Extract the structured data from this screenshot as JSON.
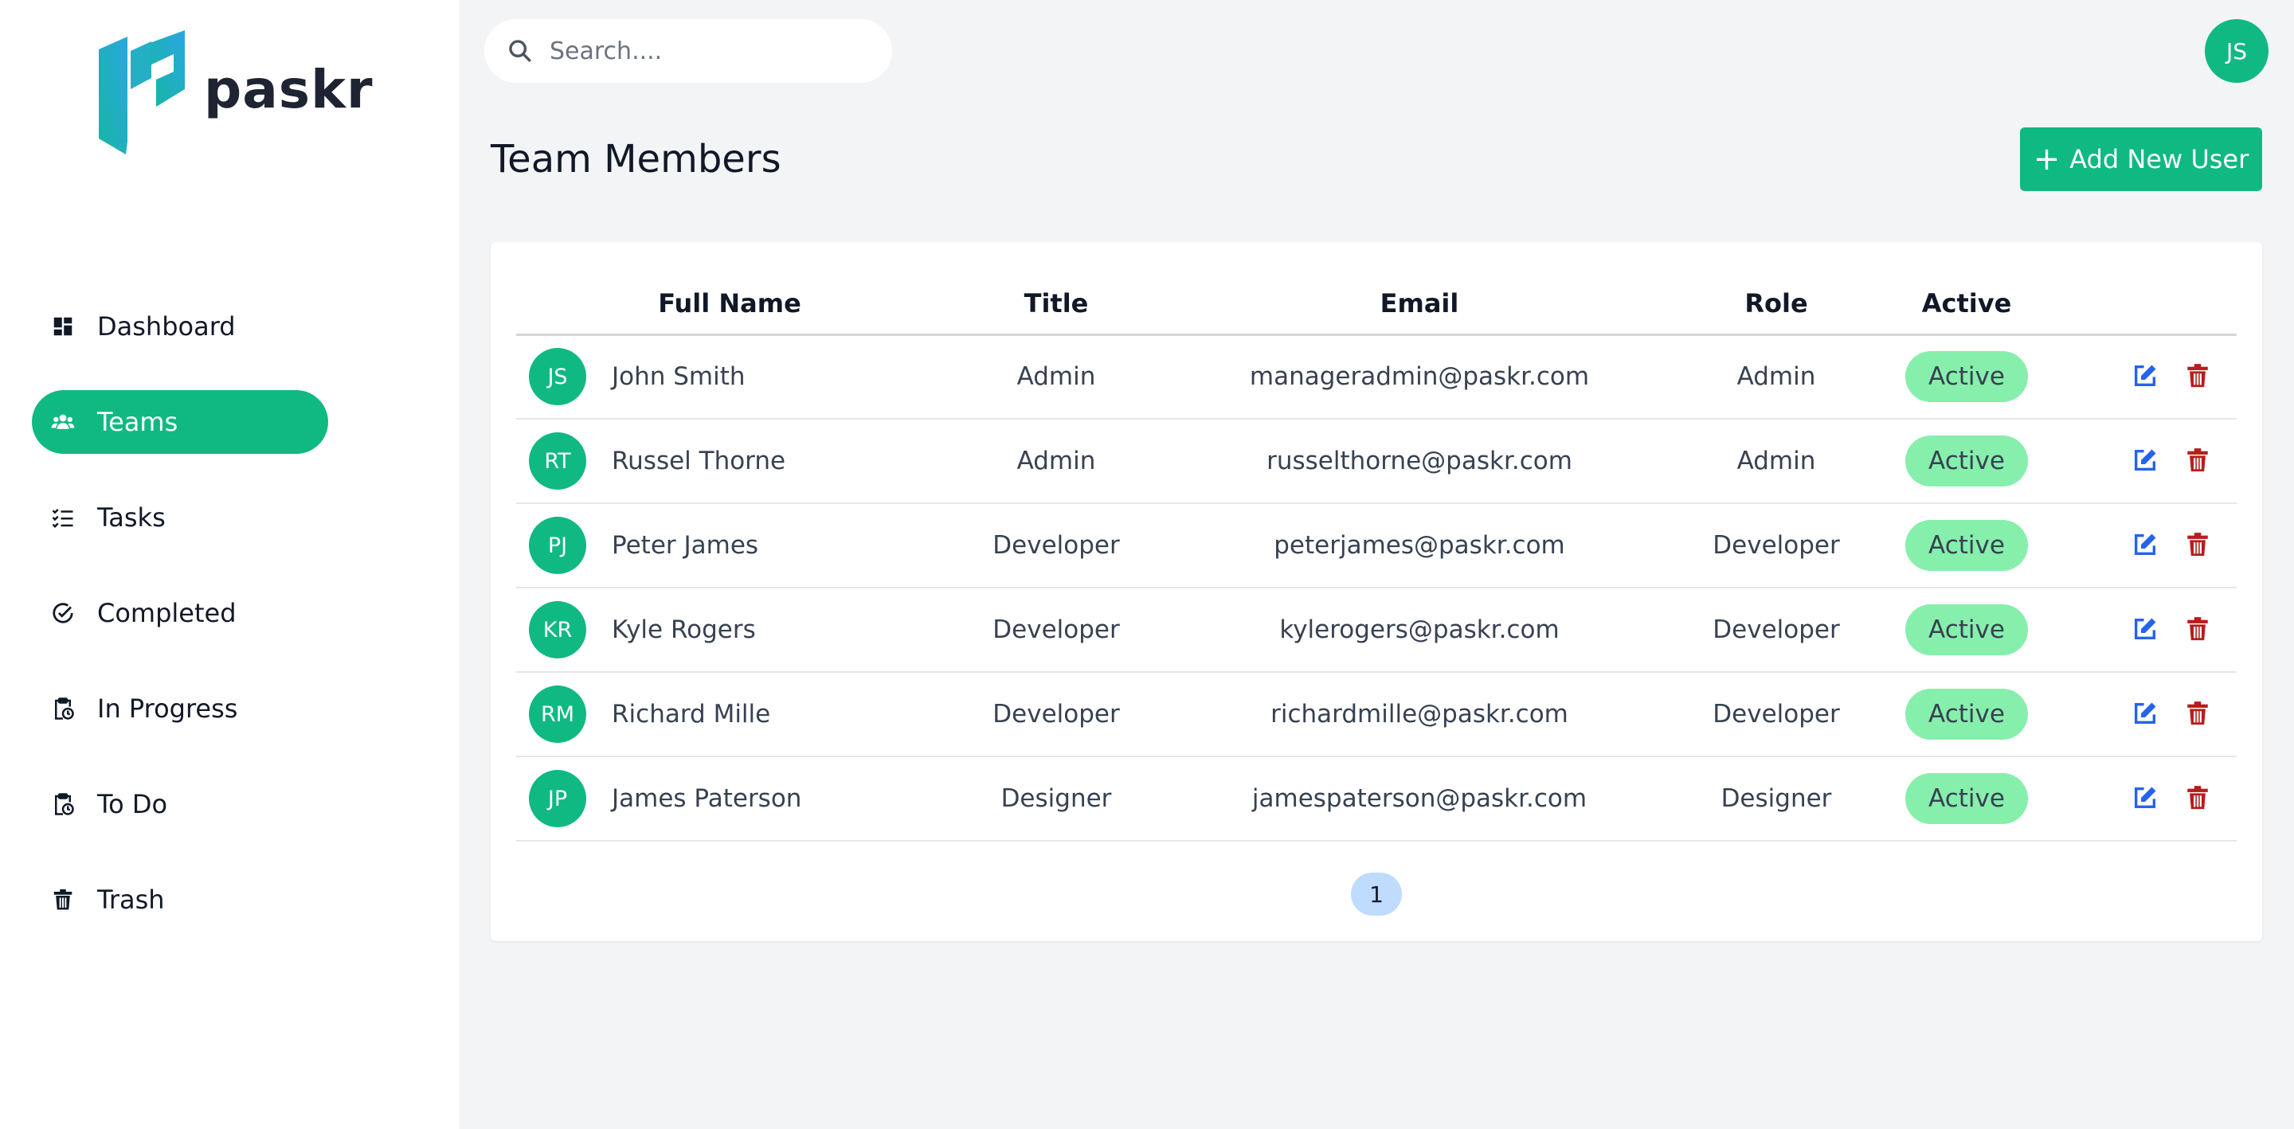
{
  "brand": {
    "name": "paskr",
    "accent": "#10b981"
  },
  "sidebar": {
    "items": [
      {
        "label": "Dashboard",
        "icon": "dashboard-icon",
        "active": false
      },
      {
        "label": "Teams",
        "icon": "users-icon",
        "active": true
      },
      {
        "label": "Tasks",
        "icon": "task-list-icon",
        "active": false
      },
      {
        "label": "Completed",
        "icon": "check-circle-icon",
        "active": false
      },
      {
        "label": "In Progress",
        "icon": "clipboard-clock-icon",
        "active": false
      },
      {
        "label": "To Do",
        "icon": "clipboard-clock-icon",
        "active": false
      },
      {
        "label": "Trash",
        "icon": "trash-icon",
        "active": false
      }
    ]
  },
  "search": {
    "placeholder": "Search...."
  },
  "user": {
    "initials": "JS"
  },
  "page": {
    "title": "Team Members",
    "add_button_label": "Add New User"
  },
  "table": {
    "headers": {
      "full_name": "Full Name",
      "title": "Title",
      "email": "Email",
      "role": "Role",
      "active": "Active"
    },
    "rows": [
      {
        "initials": "JS",
        "name": "John Smith",
        "title": "Admin",
        "email": "manageradmin@paskr.com",
        "role": "Admin",
        "status": "Active"
      },
      {
        "initials": "RT",
        "name": "Russel Thorne",
        "title": "Admin",
        "email": "russelthorne@paskr.com",
        "role": "Admin",
        "status": "Active"
      },
      {
        "initials": "PJ",
        "name": "Peter James",
        "title": "Developer",
        "email": "peterjames@paskr.com",
        "role": "Developer",
        "status": "Active"
      },
      {
        "initials": "KR",
        "name": "Kyle Rogers",
        "title": "Developer",
        "email": "kylerogers@paskr.com",
        "role": "Developer",
        "status": "Active"
      },
      {
        "initials": "RM",
        "name": "Richard Mille",
        "title": "Developer",
        "email": "richardmille@paskr.com",
        "role": "Developer",
        "status": "Active"
      },
      {
        "initials": "JP",
        "name": "James Paterson",
        "title": "Designer",
        "email": "jamespaterson@paskr.com",
        "role": "Designer",
        "status": "Active"
      }
    ]
  },
  "pagination": {
    "current_page": "1"
  },
  "colors": {
    "status_active_bg": "#86efac",
    "edit": "#2563eb",
    "delete": "#b91c1c",
    "pager_bg": "#bfdbfe"
  }
}
